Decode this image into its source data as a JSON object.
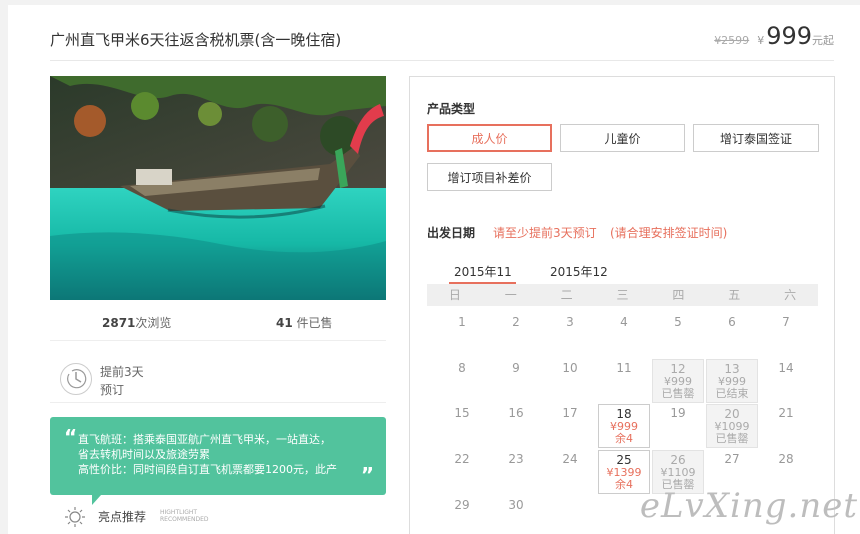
{
  "product": {
    "title": "广州直飞甲米6天往返含税机票(含一晚住宿)",
    "original_price": "¥2599",
    "currency": "¥",
    "price": "999",
    "price_suffix": "元起"
  },
  "stats": {
    "views_num": "2871",
    "views_label": "次浏览",
    "sold_num": "41",
    "sold_label": "件已售"
  },
  "advance": {
    "line1": "提前3天",
    "line2": "预订",
    "icon": "clock-icon"
  },
  "highlight": {
    "lines": [
      "直飞航班：搭乘泰国亚航广州直飞甲米，一站直达，",
      "省去转机时间以及旅途劳累",
      "高性价比：同时间段自订直飞机票都要1200元，此产"
    ],
    "label": "亮点推荐",
    "label_en_1": "HIGHTLIGHT",
    "label_en_2": "RECOMMENDED"
  },
  "booking": {
    "product_type_label": "产品类型",
    "types": [
      "成人价",
      "儿童价",
      "增订泰国签证",
      "增订项目补差价"
    ],
    "selected_type": "成人价",
    "date_label": "出发日期",
    "note1": "请至少提前3天预订",
    "note2": "(请合理安排签证时间)",
    "months": [
      "2015年11",
      "2015年12"
    ],
    "selected_month": "2015年11",
    "weekdays": [
      "日",
      "一",
      "二",
      "三",
      "四",
      "五",
      "六"
    ],
    "days": [
      {
        "d": "1"
      },
      {
        "d": "2"
      },
      {
        "d": "3"
      },
      {
        "d": "4"
      },
      {
        "d": "5"
      },
      {
        "d": "6"
      },
      {
        "d": "7"
      },
      {
        "d": "8"
      },
      {
        "d": "9"
      },
      {
        "d": "10"
      },
      {
        "d": "11"
      },
      {
        "d": "12",
        "p": "¥999",
        "r": "已售罄",
        "s": "disabled"
      },
      {
        "d": "13",
        "p": "¥999",
        "r": "已结束",
        "s": "disabled"
      },
      {
        "d": "14"
      },
      {
        "d": "15"
      },
      {
        "d": "16"
      },
      {
        "d": "17"
      },
      {
        "d": "18",
        "p": "¥999",
        "r": "余4",
        "s": "avail"
      },
      {
        "d": "19"
      },
      {
        "d": "20",
        "p": "¥1099",
        "r": "已售罄",
        "s": "disabled"
      },
      {
        "d": "21"
      },
      {
        "d": "22"
      },
      {
        "d": "23"
      },
      {
        "d": "24"
      },
      {
        "d": "25",
        "p": "¥1399",
        "r": "余4",
        "s": "avail"
      },
      {
        "d": "26",
        "p": "¥1109",
        "r": "已售罄",
        "s": "disabled"
      },
      {
        "d": "27"
      },
      {
        "d": "28"
      },
      {
        "d": "29"
      },
      {
        "d": "30"
      }
    ]
  },
  "watermark": "eLvXing.net",
  "colors": {
    "accent": "#e7705d",
    "highlight": "#52c39d",
    "divider": "#e8e8e8"
  }
}
